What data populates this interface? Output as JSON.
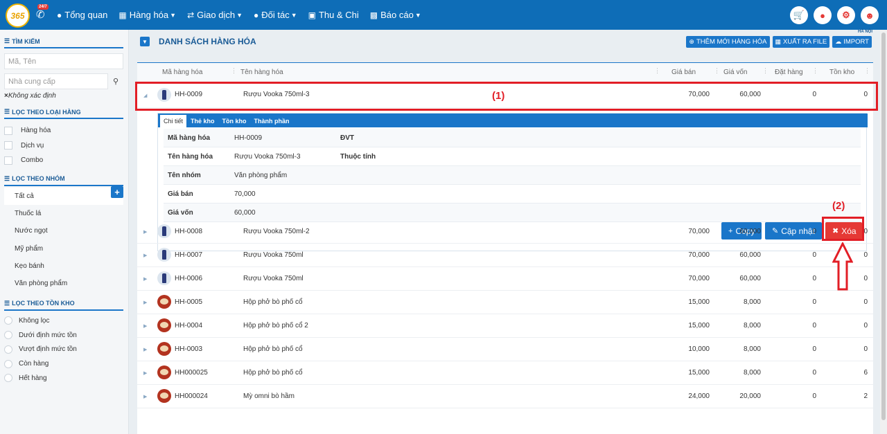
{
  "topnav": {
    "logo_text": "365",
    "badge": "24/7",
    "items": [
      {
        "icon": "dashboard-icon",
        "label": "Tổng quan",
        "caret": false
      },
      {
        "icon": "cubes-icon",
        "label": "Hàng hóa",
        "caret": true
      },
      {
        "icon": "exchange-icon",
        "label": "Giao dịch",
        "caret": true
      },
      {
        "icon": "users-icon",
        "label": "Đối tác",
        "caret": true
      },
      {
        "icon": "money-icon",
        "label": "Thu & Chi",
        "caret": false
      },
      {
        "icon": "bar-chart-icon",
        "label": "Báo cáo",
        "caret": true
      }
    ],
    "right_icons": [
      "cart-icon",
      "location-icon",
      "gear-icon",
      "user-icon"
    ]
  },
  "sidebar": {
    "search_title": "TÌM KIẾM",
    "search_placeholder": "Mã, Tên",
    "supplier_placeholder": "Nhà cung cấp",
    "supplier_tag": "Không xác định",
    "type_title": "LỌC THEO LOẠI HÀNG",
    "types": [
      "Hàng hóa",
      "Dịch vụ",
      "Combo"
    ],
    "group_title": "LỌC THEO NHÓM",
    "groups": [
      "Tất cả",
      "Thuốc lá",
      "Nước ngọt",
      "Mỹ phẩm",
      "Kẹo bánh",
      "Văn phòng phẩm"
    ],
    "stock_title": "LỌC THEO TỒN KHO",
    "stock_filters": [
      "Không lọc",
      "Dưới định mức tồn",
      "Vượt định mức tồn",
      "Còn hàng",
      "Hết hàng"
    ]
  },
  "main": {
    "title": "DANH SÁCH HÀNG HÓA",
    "location": "HÀ NỘI",
    "actions": [
      {
        "icon": "plus-circle-icon",
        "label": "THÊM MỚI HÀNG HÓA"
      },
      {
        "icon": "excel-icon",
        "label": "XUẤT RA FILE"
      },
      {
        "icon": "cloud-upload-icon",
        "label": "IMPORT"
      }
    ],
    "columns": [
      "Mã hàng hóa",
      "Tên hàng hóa",
      "Giá bán",
      "Giá vốn",
      "Đặt hàng",
      "Tồn kho"
    ],
    "selected_row": {
      "code": "HH-0009",
      "name": "Rượu Vooka 750ml-3",
      "price": "70,000",
      "cost": "60,000",
      "ordered": "0",
      "stock": "0",
      "thumb": "bottle"
    },
    "rows": [
      {
        "code": "HH-0008",
        "name": "Rượu Vooka 750ml-2",
        "price": "70,000",
        "cost": "60,000",
        "ordered": "0",
        "stock": "0",
        "thumb": "bottle"
      },
      {
        "code": "HH-0007",
        "name": "Rượu Vooka 750ml",
        "price": "70,000",
        "cost": "60,000",
        "ordered": "0",
        "stock": "0",
        "thumb": "bottle"
      },
      {
        "code": "HH-0006",
        "name": "Rượu Vooka 750ml",
        "price": "70,000",
        "cost": "60,000",
        "ordered": "0",
        "stock": "0",
        "thumb": "bottle"
      },
      {
        "code": "HH-0005",
        "name": "Hộp phở bò phố cổ",
        "price": "15,000",
        "cost": "8,000",
        "ordered": "0",
        "stock": "0",
        "thumb": "bowl"
      },
      {
        "code": "HH-0004",
        "name": "Hộp phở bò phố cổ 2",
        "price": "15,000",
        "cost": "8,000",
        "ordered": "0",
        "stock": "0",
        "thumb": "bowl"
      },
      {
        "code": "HH-0003",
        "name": "Hộp phở bò phố cổ",
        "price": "10,000",
        "cost": "8,000",
        "ordered": "0",
        "stock": "0",
        "thumb": "bowl"
      },
      {
        "code": "HH000025",
        "name": "Hộp phở bò phố cổ",
        "price": "15,000",
        "cost": "8,000",
        "ordered": "0",
        "stock": "6",
        "thumb": "bowl"
      },
      {
        "code": "HH000024",
        "name": "Mỳ omni bò hầm",
        "price": "24,000",
        "cost": "20,000",
        "ordered": "0",
        "stock": "2",
        "thumb": "bowl"
      }
    ],
    "detail": {
      "tabs": [
        "Chi tiết",
        "Thẻ kho",
        "Tồn kho",
        "Thành phần"
      ],
      "fields": [
        {
          "label": "Mã hàng hóa",
          "value": "HH-0009",
          "label2": "ĐVT"
        },
        {
          "label": "Tên hàng hóa",
          "value": "Rượu Vooka 750ml-3",
          "label2": "Thuộc tính"
        },
        {
          "label": "Tên nhóm",
          "value": "Văn phòng phẩm",
          "label2": ""
        },
        {
          "label": "Giá bán",
          "value": "70,000",
          "label2": ""
        },
        {
          "label": "Giá vốn",
          "value": "60,000",
          "label2": ""
        }
      ],
      "copy_label": "Copy",
      "update_label": "Cập nhật",
      "delete_label": "Xóa"
    },
    "annotations": {
      "label1": "(1)",
      "label2": "(2)"
    }
  }
}
